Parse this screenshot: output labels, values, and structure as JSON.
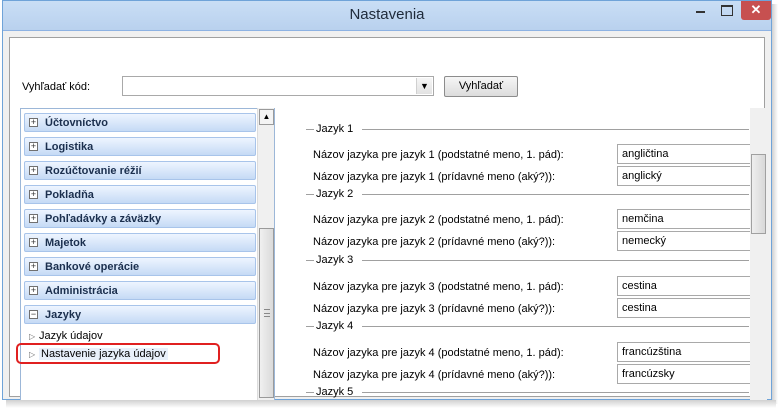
{
  "window": {
    "title": "Nastavenia"
  },
  "search": {
    "label": "Vyhľadať kód:",
    "value": "",
    "button_label": "Vyhľadať"
  },
  "nav": {
    "sections": [
      {
        "label": "Účtovníctvo",
        "expanded": false
      },
      {
        "label": "Logistika",
        "expanded": false
      },
      {
        "label": "Rozúčtovanie réžií",
        "expanded": false
      },
      {
        "label": "Pokladňa",
        "expanded": false
      },
      {
        "label": "Pohľadávky a záväzky",
        "expanded": false
      },
      {
        "label": "Majetok",
        "expanded": false
      },
      {
        "label": "Bankové operácie",
        "expanded": false
      },
      {
        "label": "Administrácia",
        "expanded": false
      },
      {
        "label": "Jazyky",
        "expanded": true
      }
    ],
    "subitems": [
      {
        "label": "Jazyk údajov"
      },
      {
        "label": "Nastavenie jazyka údajov",
        "selected": true
      }
    ]
  },
  "languages": [
    {
      "group": "Jazyk 1",
      "noun_label": "Názov jazyka pre jazyk 1 (podstatné meno, 1. pád):",
      "noun_value": "angličtina",
      "adj_label": "Názov jazyka pre jazyk 1 (prídavné meno (aký?)):",
      "adj_value": "anglický"
    },
    {
      "group": "Jazyk 2",
      "noun_label": "Názov jazyka pre jazyk 2 (podstatné meno, 1. pád):",
      "noun_value": "nemčina",
      "adj_label": "Názov jazyka pre jazyk 2 (prídavné meno (aký?)):",
      "adj_value": "nemecký"
    },
    {
      "group": "Jazyk 3",
      "noun_label": "Názov jazyka pre jazyk 3 (podstatné meno, 1. pád):",
      "noun_value": "cestina",
      "adj_label": "Názov jazyka pre jazyk 3 (prídavné meno (aký?)):",
      "adj_value": "cestina"
    },
    {
      "group": "Jazyk 4",
      "noun_label": "Názov jazyka pre jazyk 4 (podstatné meno, 1. pád):",
      "noun_value": "francúzština",
      "adj_label": "Názov jazyka pre jazyk 4 (prídavné meno (aký?)):",
      "adj_value": "francúzsky"
    },
    {
      "group": "Jazyk 5"
    }
  ],
  "colors": {
    "highlight_ring": "#e02020",
    "nav_header": "#c5daf5",
    "close_button": "#c75050"
  }
}
